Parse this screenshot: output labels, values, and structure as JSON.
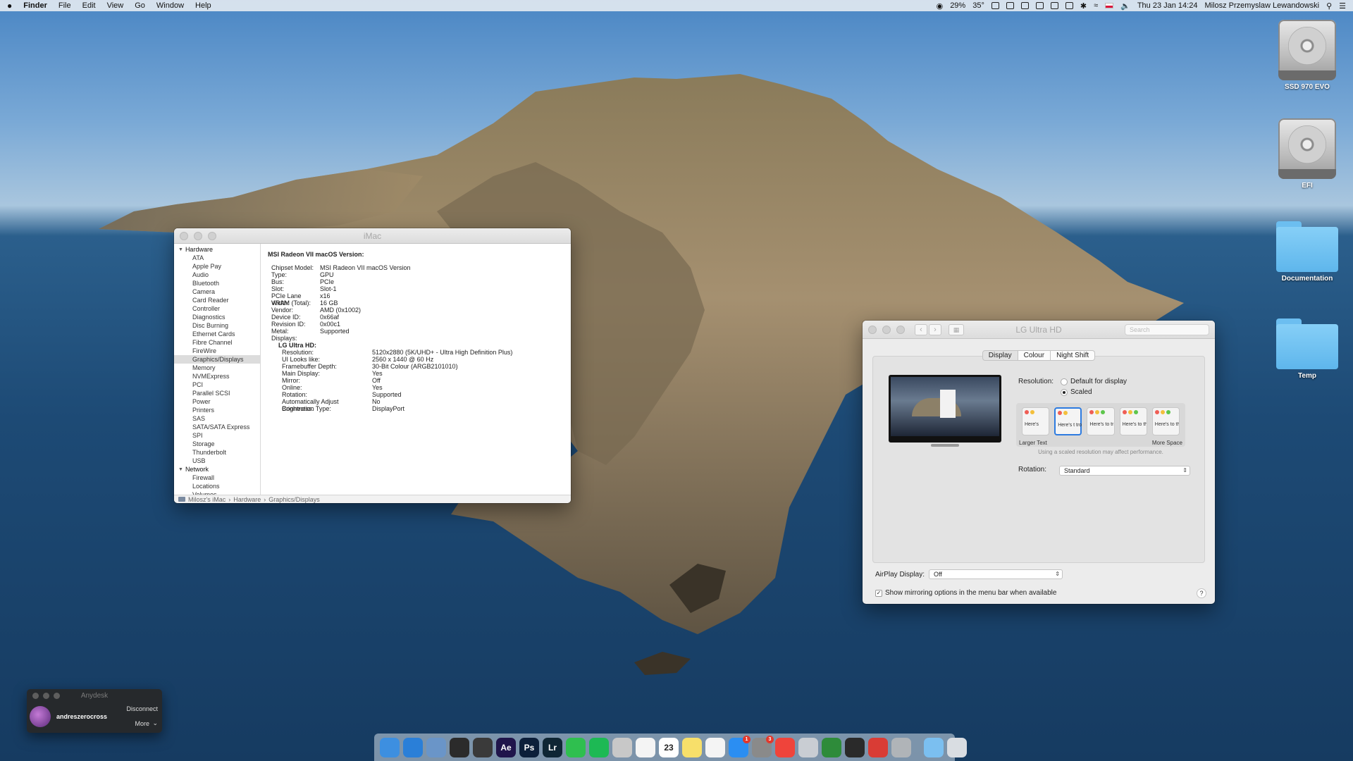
{
  "menubar": {
    "apple": "",
    "items": [
      "Finder",
      "File",
      "Edit",
      "View",
      "Go",
      "Window",
      "Help"
    ],
    "battery": "29%",
    "temp": "35°",
    "datetime": "Thu 23 Jan  14:24",
    "user": "Milosz Przemyslaw Lewandowski"
  },
  "desktop": {
    "icons": [
      "SSD 970 EVO",
      "EFI",
      "Documentation",
      "Temp"
    ]
  },
  "sysinfo": {
    "title": "iMac",
    "sidebar": {
      "hardware": "Hardware",
      "hardware_items": [
        "ATA",
        "Apple Pay",
        "Audio",
        "Bluetooth",
        "Camera",
        "Card Reader",
        "Controller",
        "Diagnostics",
        "Disc Burning",
        "Ethernet Cards",
        "Fibre Channel",
        "FireWire",
        "Graphics/Displays",
        "Memory",
        "NVMExpress",
        "PCI",
        "Parallel SCSI",
        "Power",
        "Printers",
        "SAS",
        "SATA/SATA Express",
        "SPI",
        "Storage",
        "Thunderbolt",
        "USB"
      ],
      "network": "Network",
      "network_items": [
        "Firewall",
        "Locations",
        "Volumes"
      ]
    },
    "detail": {
      "heading": "MSI Radeon VII macOS Version:",
      "rows": [
        [
          "Chipset Model:",
          "MSI Radeon VII macOS Version"
        ],
        [
          "Type:",
          "GPU"
        ],
        [
          "Bus:",
          "PCIe"
        ],
        [
          "Slot:",
          "Slot-1"
        ],
        [
          "PCIe Lane Width:",
          "x16"
        ],
        [
          "VRAM (Total):",
          "16 GB"
        ],
        [
          "Vendor:",
          "AMD (0x1002)"
        ],
        [
          "Device ID:",
          "0x66af"
        ],
        [
          "Revision ID:",
          "0x00c1"
        ],
        [
          "Metal:",
          "Supported"
        ],
        [
          "Displays:",
          ""
        ]
      ],
      "display_name": "LG Ultra HD:",
      "display_rows": [
        [
          "Resolution:",
          "5120x2880 (5K/UHD+ - Ultra High Definition Plus)"
        ],
        [
          "UI Looks like:",
          "2560 x 1440 @ 60 Hz"
        ],
        [
          "Framebuffer Depth:",
          "30-Bit Colour (ARGB2101010)"
        ],
        [
          "Main Display:",
          "Yes"
        ],
        [
          "Mirror:",
          "Off"
        ],
        [
          "Online:",
          "Yes"
        ],
        [
          "Rotation:",
          "Supported"
        ],
        [
          "Automatically Adjust Brightness:",
          "No"
        ],
        [
          "Connection Type:",
          "DisplayPort"
        ]
      ]
    },
    "path": [
      "Milosz's iMac",
      "Hardware",
      "Graphics/Displays"
    ]
  },
  "display_prefs": {
    "title": "LG Ultra HD",
    "search_placeholder": "Search",
    "tabs": [
      "Display",
      "Colour",
      "Night Shift"
    ],
    "resolution_label": "Resolution:",
    "res_default": "Default for display",
    "res_scaled": "Scaled",
    "scale_options": [
      "Here's",
      "Here's t troublem",
      "Here's to troublema ones who",
      "Here's to the troublemakers, the round pegs",
      "Here's to the crazy ones, the misfits, the rebels"
    ],
    "larger_text": "Larger Text",
    "more_space": "More Space",
    "perf_note": "Using a scaled resolution may affect performance.",
    "rotation_label": "Rotation:",
    "rotation_value": "Standard",
    "airplay_label": "AirPlay Display:",
    "airplay_value": "Off",
    "mirror_option": "Show mirroring options in the menu bar when available",
    "help": "?"
  },
  "anydesk": {
    "title": "Anydesk",
    "user": "andreszerocross",
    "disconnect": "Disconnect",
    "more": "More"
  },
  "dock": {
    "apps": [
      {
        "name": "finder-app",
        "label": "",
        "color": "#3d8fe0"
      },
      {
        "name": "safari-app",
        "label": "",
        "color": "#2a7fd8"
      },
      {
        "name": "preview-app",
        "label": "",
        "color": "#6a95c8"
      },
      {
        "name": "davinci-app",
        "label": "",
        "color": "#2b2b2b"
      },
      {
        "name": "finalcut-app",
        "label": "",
        "color": "#3a3a3a"
      },
      {
        "name": "aftereffects-app",
        "label": "Ae",
        "color": "#20154b"
      },
      {
        "name": "photoshop-app",
        "label": "Ps",
        "color": "#0c1f3a"
      },
      {
        "name": "lightroom-app",
        "label": "Lr",
        "color": "#0f2634"
      },
      {
        "name": "whatsapp-app",
        "label": "",
        "color": "#2fbf4f"
      },
      {
        "name": "spotify-app",
        "label": "",
        "color": "#1db954"
      },
      {
        "name": "script-editor-app",
        "label": "",
        "color": "#c8c8c8"
      },
      {
        "name": "photos-app",
        "label": "",
        "color": "#f4f4f4"
      },
      {
        "name": "calendar-app",
        "label": "23",
        "color": "#ffffff"
      },
      {
        "name": "notes-app",
        "label": "",
        "color": "#f7df6a"
      },
      {
        "name": "itunes-app",
        "label": "",
        "color": "#f4f4f4"
      },
      {
        "name": "appstore-app",
        "label": "",
        "color": "#2b8ef2",
        "badge": "1"
      },
      {
        "name": "system-prefs-app",
        "label": "",
        "color": "#8a8a8a",
        "badge": "3"
      },
      {
        "name": "anydesk-app",
        "label": "",
        "color": "#ef443b"
      },
      {
        "name": "archive-app",
        "label": "",
        "color": "#c9cdd3"
      },
      {
        "name": "istat-app",
        "label": "",
        "color": "#2e8b3a"
      },
      {
        "name": "terminal-app",
        "label": "",
        "color": "#2a2a2a"
      },
      {
        "name": "remote-app",
        "label": "",
        "color": "#d93c35"
      },
      {
        "name": "automator-app",
        "label": "",
        "color": "#b0b4b8"
      }
    ],
    "folders": [
      {
        "name": "downloads-stack",
        "color": "#7bbff0"
      },
      {
        "name": "trash-icon",
        "color": "#d9dde2"
      }
    ]
  }
}
